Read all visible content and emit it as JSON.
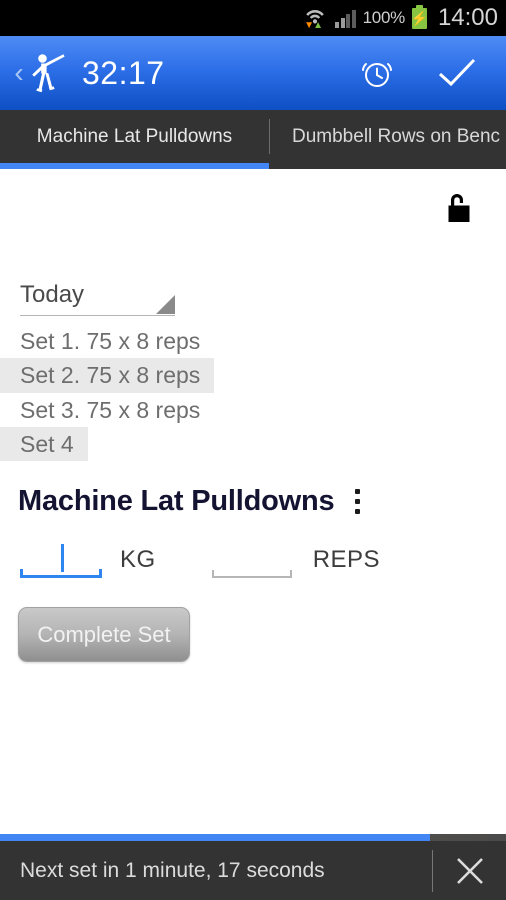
{
  "status_bar": {
    "wifi_icon": "wifi-icon",
    "wifi_transfer_icon": "data-transfer-icon",
    "signal_icon": "cell-signal-icon",
    "battery_percent": "100%",
    "battery_icon": "battery-charging-icon",
    "clock": "14:00"
  },
  "app_bar": {
    "back_icon": "back-chevron-icon",
    "app_icon": "exercise-figure-icon",
    "timer": "32:17",
    "alarm_icon": "alarm-clock-icon",
    "confirm_icon": "checkmark-icon"
  },
  "tabs": {
    "items": [
      {
        "label": "Machine Lat Pulldowns",
        "active": true
      },
      {
        "label": "Dumbbell Rows on Benc",
        "active": false
      }
    ]
  },
  "content": {
    "lock_icon": "unlocked-padlock-icon",
    "date_picker": {
      "value": "Today",
      "arrow_icon": "dropdown-triangle-icon"
    },
    "sets": [
      {
        "text": "Set 1. 75 x 8 reps",
        "highlighted": false
      },
      {
        "text": "Set 2. 75 x 8 reps",
        "highlighted": true
      },
      {
        "text": "Set 3. 75 x 8 reps",
        "highlighted": false
      },
      {
        "text": "Set 4",
        "highlighted": true
      }
    ],
    "exercise_title": "Machine Lat Pulldowns",
    "overflow_icon": "more-vertical-icon",
    "weight_field": {
      "value": "",
      "unit": "KG",
      "focused": true
    },
    "reps_field": {
      "value": "",
      "unit": "REPS",
      "focused": false
    },
    "complete_button": "Complete Set"
  },
  "bottom_bar": {
    "rest_text": "Next set in 1 minute, 17 seconds",
    "close_icon": "close-x-icon",
    "progress_percent": 85
  },
  "colors": {
    "accent_blue": "#4285f4",
    "app_bar_blue": "#2d6fe8",
    "dark_chrome": "#333333",
    "title_navy": "#141432",
    "highlight_gray": "#e9e9e9"
  }
}
